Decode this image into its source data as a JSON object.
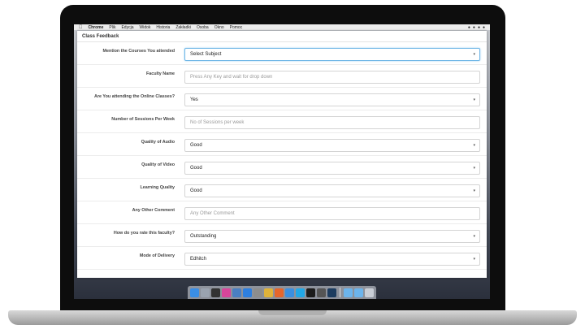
{
  "menubar": {
    "apple": "",
    "app": "Chrome",
    "items": [
      "Plik",
      "Edycja",
      "Widok",
      "Historia",
      "Zakładki",
      "Osoba",
      "Okno",
      "Pomoc"
    ]
  },
  "page": {
    "title": "Class Feedback"
  },
  "form": {
    "rows": [
      {
        "label": "Mention the Courses You attended",
        "value": "Select Subject",
        "kind": "select"
      },
      {
        "label": "Faculty Name",
        "value": "Press Any Key and wait for drop down",
        "kind": "placeholder"
      },
      {
        "label": "Are You attending the Online Classes?",
        "value": "Yes",
        "kind": "select"
      },
      {
        "label": "Number of Sessions Per Week",
        "value": "No of Sessions per week",
        "kind": "placeholder"
      },
      {
        "label": "Quality of Audio",
        "value": "Good",
        "kind": "select"
      },
      {
        "label": "Quality of Video",
        "value": "Good",
        "kind": "select"
      },
      {
        "label": "Learning Quality",
        "value": "Good",
        "kind": "select"
      },
      {
        "label": "Any Other Comment",
        "value": "Any Other Comment",
        "kind": "placeholder"
      },
      {
        "label": "How do you rate this faculty?",
        "value": "Outstanding",
        "kind": "select"
      },
      {
        "label": "Mode of Delivery",
        "value": "Edhitch",
        "kind": "select"
      }
    ]
  },
  "dock": {
    "icons": [
      {
        "name": "finder-icon",
        "color": "#3a8ee6"
      },
      {
        "name": "launchpad-icon",
        "color": "#9aa3b0"
      },
      {
        "name": "dvd-icon",
        "color": "#333333"
      },
      {
        "name": "itunes-icon",
        "color": "#d8459b"
      },
      {
        "name": "globe-icon",
        "color": "#4a7fc2"
      },
      {
        "name": "app-store-icon",
        "color": "#2d7fe0"
      },
      {
        "name": "settings-icon",
        "color": "#8d8d8d"
      },
      {
        "name": "chrome-icon",
        "color": "#e0b33a"
      },
      {
        "name": "firefox-icon",
        "color": "#e5662c"
      },
      {
        "name": "safari-icon",
        "color": "#3b8fe0"
      },
      {
        "name": "skype-icon",
        "color": "#22a7e6"
      },
      {
        "name": "terminal-icon",
        "color": "#1c1c1c"
      },
      {
        "name": "app-icon",
        "color": "#555555"
      },
      {
        "name": "photoshop-icon",
        "color": "#1d3c5f"
      },
      {
        "name": "folder-icon",
        "color": "#6cb4ec"
      },
      {
        "name": "downloads-icon",
        "color": "#6cb4ec"
      },
      {
        "name": "trash-icon",
        "color": "#c9ced6"
      }
    ]
  }
}
